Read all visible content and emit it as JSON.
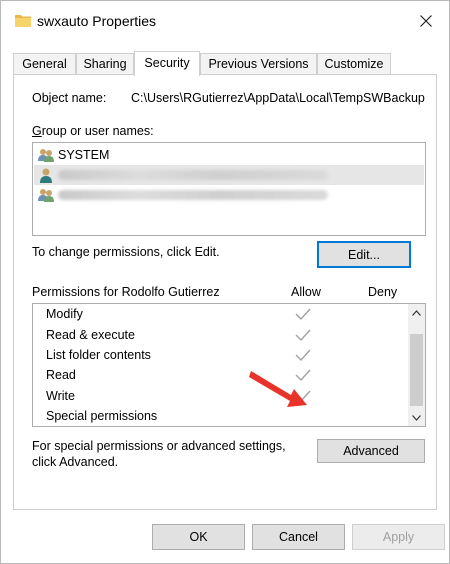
{
  "window": {
    "title": "swxauto Properties"
  },
  "tabs": [
    {
      "label": "General"
    },
    {
      "label": "Sharing"
    },
    {
      "label": "Security"
    },
    {
      "label": "Previous Versions"
    },
    {
      "label": "Customize"
    }
  ],
  "security": {
    "object_name_label": "Object name:",
    "object_name_value": "C:\\Users\\RGutierrez\\AppData\\Local\\TempSWBackup",
    "group_label": "Group or user names:",
    "users": [
      {
        "name": "SYSTEM",
        "icon": "users-group-icon"
      },
      {
        "name": "",
        "icon": "user-icon",
        "redacted": true
      },
      {
        "name": "",
        "icon": "users-group-icon",
        "redacted": true
      }
    ],
    "change_text": "To change permissions, click Edit.",
    "edit_label": "Edit...",
    "permissions_label": "Permissions for Rodolfo Gutierrez",
    "allow_header": "Allow",
    "deny_header": "Deny",
    "permissions": [
      {
        "name": "Modify",
        "allow": true,
        "deny": false
      },
      {
        "name": "Read & execute",
        "allow": true,
        "deny": false
      },
      {
        "name": "List folder contents",
        "allow": true,
        "deny": false
      },
      {
        "name": "Read",
        "allow": true,
        "deny": false
      },
      {
        "name": "Write",
        "allow": true,
        "deny": false
      },
      {
        "name": "Special permissions",
        "allow": false,
        "deny": false
      }
    ],
    "special_text": "For special permissions or advanced settings, click Advanced.",
    "advanced_label": "Advanced"
  },
  "footer": {
    "ok_label": "OK",
    "cancel_label": "Cancel",
    "apply_label": "Apply"
  },
  "colors": {
    "accent": "#0078d7",
    "annotation_arrow": "#e8332a",
    "check_gray": "#a0a0a0"
  }
}
